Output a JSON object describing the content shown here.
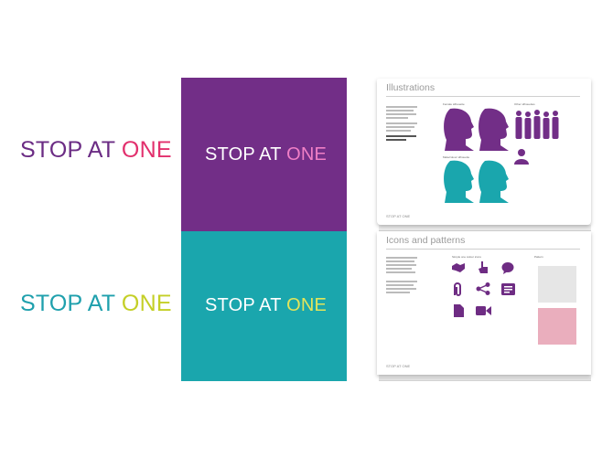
{
  "logos": {
    "primary": {
      "stop": "STOP AT ",
      "one": "ONE"
    },
    "secondary": {
      "stop": "STOP AT ",
      "one": "ONE"
    },
    "purple_panel": {
      "stop": "STOP AT ",
      "one": "ONE"
    },
    "teal_panel": {
      "stop": "STOP AT ",
      "one": "ONE"
    }
  },
  "guide_pages": {
    "illustrations": {
      "title": "Illustrations",
      "col1_heading": "Female silhouette",
      "col2_heading": "Other silhouettes",
      "col3_heading": "Male/colour silhouette",
      "footer": "STOP AT ONE"
    },
    "icons": {
      "title": "Icons and patterns",
      "col1_heading": "Simple one colour icons",
      "col2_heading": "Pattern",
      "footer": "STOP AT ONE"
    }
  },
  "colors": {
    "purple": "#722e87",
    "teal": "#1aa6ad",
    "pink": "#e2306d",
    "lime": "#c4cf27"
  }
}
